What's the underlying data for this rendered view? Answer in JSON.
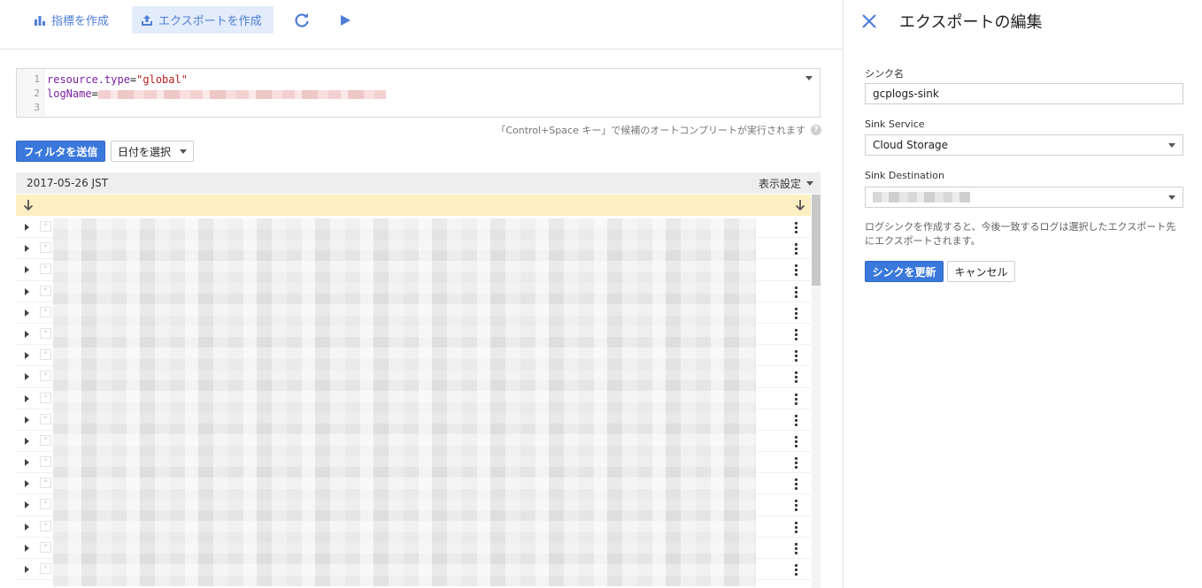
{
  "toolbar": {
    "create_metric": "指標を作成",
    "create_export": "エクスポートを作成"
  },
  "query": {
    "line_numbers": [
      "1",
      "2",
      "3"
    ],
    "line1_key": "resource.type",
    "line1_op": "=",
    "line1_value": "\"global\"",
    "line2_key": "logName",
    "line2_op": "="
  },
  "hint": "「Control+Space キー」で候補のオートコンプリートが実行されます",
  "filter_submit": "フィルタを送信",
  "date_select": "日付を選択",
  "log": {
    "date_label": "2017-05-26 JST",
    "display_settings": "表示設定",
    "row_count": 17
  },
  "panel": {
    "title": "エクスポートの編集",
    "sink_name_label": "シンク名",
    "sink_name_value": "gcplogs-sink",
    "sink_service_label": "Sink Service",
    "sink_service_value": "Cloud Storage",
    "sink_destination_label": "Sink Destination",
    "description": "ログシンクを作成すると、今後一致するログは選択したエクスポート先にエクスポートされます。",
    "update_button": "シンクを更新",
    "cancel_button": "キャンセル"
  },
  "colors": {
    "accent": "#3a78dc",
    "toolbar_text": "#4f7ed8",
    "banner": "#fcefc1"
  }
}
